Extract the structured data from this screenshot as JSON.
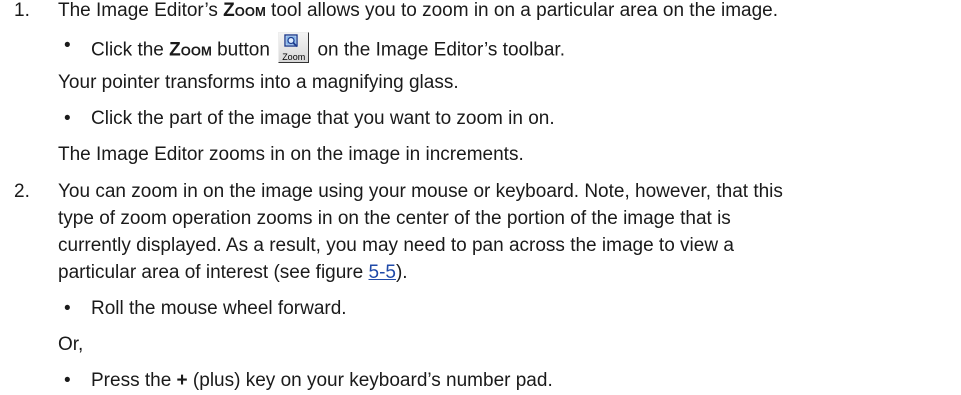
{
  "step1": {
    "number": "1.",
    "text_before": "The Image Editor’s ",
    "zoom_word": "Zoom",
    "text_after": " tool allows you to zoom in on a particular area on the image.",
    "bullet1": {
      "bullet": "•",
      "text_before": "Click the ",
      "zoom_word": "Zoom",
      "text_mid": " button ",
      "text_after": " on the Image Editor’s toolbar."
    },
    "result1": "Your pointer transforms into a magnifying glass.",
    "bullet2": {
      "bullet": "•",
      "text": "Click the part of the image that you want to zoom in on."
    },
    "result2": "The Image Editor zooms in on the image in increments."
  },
  "zoom_button": {
    "label": "Zoom",
    "icon": "magnifier-icon"
  },
  "step2": {
    "number": "2.",
    "line1": "You can zoom in on the image using your mouse or keyboard. Note, however, that this",
    "line2": "type of zoom operation zooms in on the center of the portion of the image that is",
    "line3": "currently displayed. As a result, you may need to pan across the image to view a",
    "line4_before": "particular area of interest (see figure ",
    "figure_link": "5-5",
    "line4_after": ").",
    "bullet1": {
      "bullet": "•",
      "text": "Roll the mouse wheel forward."
    },
    "or_text": "Or,",
    "bullet2": {
      "bullet": "•",
      "text_before": "Press the ",
      "plus": "+",
      "text_after": " (plus) key on your keyboard’s number pad."
    }
  },
  "colors": {
    "text": "#1a1a1a",
    "link": "#1f49a8"
  }
}
